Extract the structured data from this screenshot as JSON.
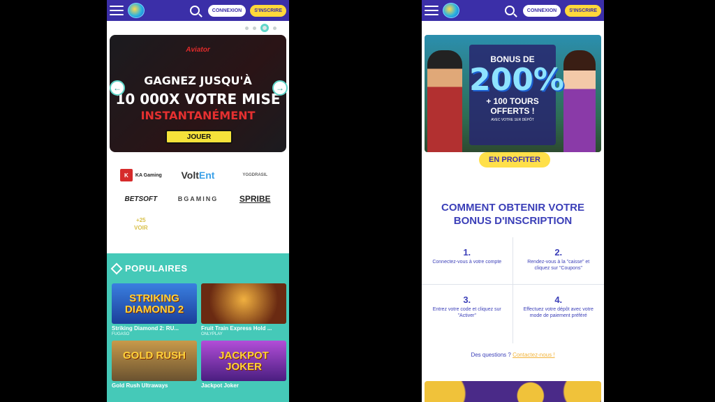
{
  "header": {
    "login_label": "CONNEXION",
    "signup_label": "S'INSCRIRE"
  },
  "left": {
    "hero": {
      "brand": "Aviator",
      "line1": "GAGNEZ JUSQU'À",
      "line2": "10 000X VOTRE MISE",
      "line3": "INSTANTANÉMENT",
      "button": "JOUER",
      "prev_glyph": "←",
      "next_glyph": "→"
    },
    "providers": {
      "ka_mark": "K",
      "ka": "KA Gaming",
      "volt_main": "Volt",
      "volt_accent": "Ent",
      "ygg": "YGGDRASIL",
      "betsoft": "BETSOFT",
      "bgaming": "BGAMING",
      "spribe": "SPRIBE",
      "more": "+25\nVOIR"
    },
    "popular": {
      "heading": "POPULAIRES",
      "games": [
        {
          "thumb": "STRIKING DIAMOND 2",
          "title": "Striking Diamond 2: RU...",
          "studio": "FUGASO"
        },
        {
          "thumb": "",
          "title": "Fruit Train Express Hold ...",
          "studio": "ONLYPLAY"
        },
        {
          "thumb": "GOLD RUSH",
          "title": "Gold Rush Ultraways",
          "studio": ""
        },
        {
          "thumb": "JACKPOT JOKER",
          "title": "Jackpot Joker",
          "studio": ""
        }
      ]
    }
  },
  "right": {
    "promo": {
      "line1": "BONUS DE",
      "big": "200%",
      "line2": "+ 100 TOURS",
      "line3": "OFFERTS !",
      "small": "AVEC VOTRE 1ER DÉPÔT",
      "button": "EN PROFITER"
    },
    "how": {
      "title_line1": "COMMENT OBTENIR VOTRE",
      "title_line2": "BONUS D'INSCRIPTION",
      "steps": [
        {
          "num": "1.",
          "text": "Connectez-vous à votre compte"
        },
        {
          "num": "2.",
          "text": "Rendez-vous à la \"caisse\" et cliquez sur \"Coupons\""
        },
        {
          "num": "3.",
          "text": "Entrez votre code et cliquez sur \"Activer\""
        },
        {
          "num": "4.",
          "text": "Effectuez votre dépôt avec votre mode de paiement préféré"
        }
      ],
      "questions": "Des questions ?",
      "contact": "Contactez-nous !"
    }
  }
}
